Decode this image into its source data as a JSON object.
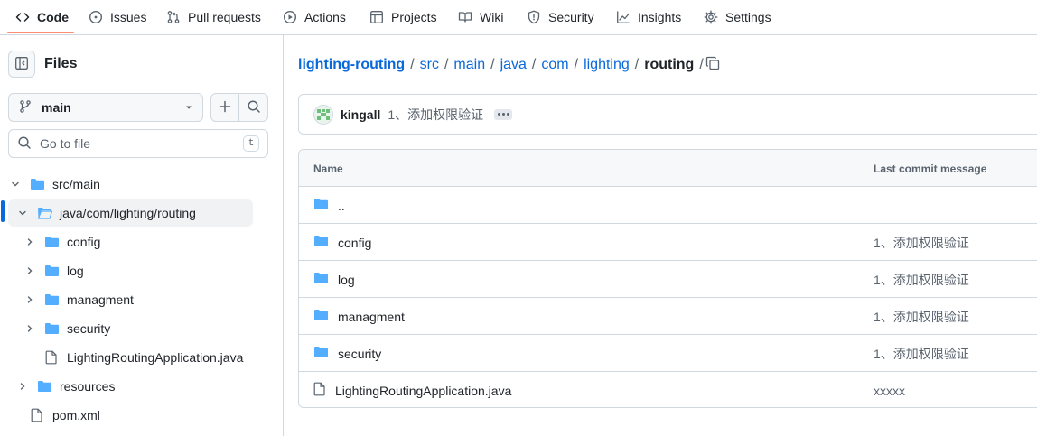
{
  "colors": {
    "accent": "#0969da",
    "folder": "#54aeff",
    "tab_underline": "#fd8c73",
    "border": "#d1d9e0"
  },
  "nav": {
    "tabs": [
      {
        "label": "Code",
        "icon": "code-icon",
        "active": true
      },
      {
        "label": "Issues",
        "icon": "issue-opened-icon"
      },
      {
        "label": "Pull requests",
        "icon": "git-pull-request-icon"
      },
      {
        "label": "Actions",
        "icon": "play-icon"
      },
      {
        "label": "Projects",
        "icon": "table-icon"
      },
      {
        "label": "Wiki",
        "icon": "book-icon"
      },
      {
        "label": "Security",
        "icon": "shield-icon"
      },
      {
        "label": "Insights",
        "icon": "graph-icon"
      },
      {
        "label": "Settings",
        "icon": "gear-icon"
      }
    ]
  },
  "sidebar": {
    "title": "Files",
    "branch": "main",
    "search_placeholder": "Go to file",
    "search_shortcut": "t",
    "tree": [
      {
        "label": "src/main",
        "type": "folder",
        "expanded": true
      },
      {
        "label": "java/com/lighting/routing",
        "type": "folder",
        "expanded": true,
        "selected": true
      },
      {
        "label": "config",
        "type": "folder"
      },
      {
        "label": "log",
        "type": "folder"
      },
      {
        "label": "managment",
        "type": "folder"
      },
      {
        "label": "security",
        "type": "folder"
      },
      {
        "label": "LightingRoutingApplication.java",
        "type": "file"
      },
      {
        "label": "resources",
        "type": "folder"
      },
      {
        "label": "pom.xml",
        "type": "file"
      }
    ]
  },
  "breadcrumb": {
    "repo": "lighting-routing",
    "parts": [
      "src",
      "main",
      "java",
      "com",
      "lighting"
    ],
    "current": "routing",
    "sep": "/"
  },
  "commit": {
    "author": "kingall",
    "message": "1、添加权限验证"
  },
  "table": {
    "headers": {
      "name": "Name",
      "message": "Last commit message"
    },
    "rows": [
      {
        "name": "..",
        "type": "folder",
        "message": ""
      },
      {
        "name": "config",
        "type": "folder",
        "message": "1、添加权限验证"
      },
      {
        "name": "log",
        "type": "folder",
        "message": "1、添加权限验证"
      },
      {
        "name": "managment",
        "type": "folder",
        "message": "1、添加权限验证"
      },
      {
        "name": "security",
        "type": "folder",
        "message": "1、添加权限验证"
      },
      {
        "name": "LightingRoutingApplication.java",
        "type": "file",
        "message": "xxxxx"
      }
    ]
  }
}
